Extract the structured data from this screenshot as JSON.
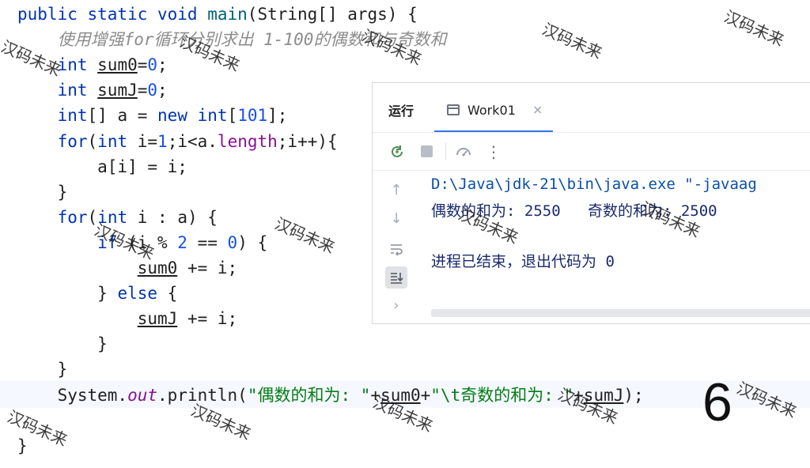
{
  "editor": {
    "lines": [
      {
        "segments": [
          {
            "t": "public static void ",
            "c": "kw"
          },
          {
            "t": "main",
            "c": "fn"
          },
          {
            "t": "(String[] args) {",
            "c": ""
          }
        ]
      },
      {
        "segments": [
          {
            "t": "    使用增强for循环分别求出 1-100的偶数和与奇数和",
            "c": "comment"
          }
        ]
      },
      {
        "segments": [
          {
            "t": "    int ",
            "c": "kw"
          },
          {
            "t": "sum0",
            "c": "underline"
          },
          {
            "t": "=",
            "c": ""
          },
          {
            "t": "0",
            "c": "num"
          },
          {
            "t": ";",
            "c": ""
          }
        ]
      },
      {
        "segments": [
          {
            "t": "    int ",
            "c": "kw"
          },
          {
            "t": "sumJ",
            "c": "underline"
          },
          {
            "t": "=",
            "c": ""
          },
          {
            "t": "0",
            "c": "num"
          },
          {
            "t": ";",
            "c": ""
          }
        ]
      },
      {
        "segments": [
          {
            "t": "    int",
            "c": "kw"
          },
          {
            "t": "[] a = ",
            "c": ""
          },
          {
            "t": "new int",
            "c": "kw"
          },
          {
            "t": "[",
            "c": ""
          },
          {
            "t": "101",
            "c": "num"
          },
          {
            "t": "];",
            "c": ""
          }
        ]
      },
      {
        "segments": [
          {
            "t": "    for",
            "c": "kw"
          },
          {
            "t": "(",
            "c": ""
          },
          {
            "t": "int ",
            "c": "kw"
          },
          {
            "t": "i=",
            "c": ""
          },
          {
            "t": "1",
            "c": "num"
          },
          {
            "t": ";i<a.",
            "c": ""
          },
          {
            "t": "length",
            "c": "field"
          },
          {
            "t": ";i++){",
            "c": ""
          }
        ]
      },
      {
        "segments": [
          {
            "t": "        a[i] = i;",
            "c": ""
          }
        ]
      },
      {
        "segments": [
          {
            "t": "    }",
            "c": ""
          }
        ]
      },
      {
        "segments": [
          {
            "t": "    for",
            "c": "kw"
          },
          {
            "t": "(",
            "c": ""
          },
          {
            "t": "int ",
            "c": "kw"
          },
          {
            "t": "i : a) {",
            "c": ""
          }
        ]
      },
      {
        "segments": [
          {
            "t": "        if ",
            "c": "kw"
          },
          {
            "t": "(i % ",
            "c": ""
          },
          {
            "t": "2",
            "c": "num"
          },
          {
            "t": " == ",
            "c": ""
          },
          {
            "t": "0",
            "c": "num"
          },
          {
            "t": ") {",
            "c": ""
          }
        ]
      },
      {
        "segments": [
          {
            "t": "            ",
            "c": ""
          },
          {
            "t": "sum0",
            "c": "underline"
          },
          {
            "t": " += i;",
            "c": ""
          }
        ]
      },
      {
        "segments": [
          {
            "t": "        } ",
            "c": ""
          },
          {
            "t": "else",
            "c": "kw"
          },
          {
            "t": " {",
            "c": ""
          }
        ]
      },
      {
        "segments": [
          {
            "t": "            ",
            "c": ""
          },
          {
            "t": "sumJ",
            "c": "underline"
          },
          {
            "t": " += i;",
            "c": ""
          }
        ]
      },
      {
        "segments": [
          {
            "t": "        }",
            "c": ""
          }
        ]
      },
      {
        "segments": [
          {
            "t": "    }",
            "c": ""
          }
        ]
      },
      {
        "segments": [
          {
            "t": "    System.",
            "c": ""
          },
          {
            "t": "out",
            "c": "italic"
          },
          {
            "t": ".println(",
            "c": ""
          },
          {
            "t": "\"偶数的和为: \"",
            "c": "str"
          },
          {
            "t": "+",
            "c": ""
          },
          {
            "t": "sum0",
            "c": "underline"
          },
          {
            "t": "+",
            "c": ""
          },
          {
            "t": "\"\\t奇数的和为: \"",
            "c": "str"
          },
          {
            "t": "+",
            "c": ""
          },
          {
            "t": "sumJ",
            "c": "underline"
          },
          {
            "t": ");",
            "c": ""
          }
        ]
      },
      {
        "segments": [
          {
            "t": "",
            "c": ""
          }
        ]
      },
      {
        "segments": [
          {
            "t": "}",
            "c": ""
          }
        ]
      }
    ]
  },
  "run_panel": {
    "title": "运行",
    "tab_label": "Work01",
    "tab_close": "×",
    "more_label": "⋮",
    "output": {
      "command": "D:\\Java\\jdk-21\\bin\\java.exe \"-javaag",
      "result": "偶数的和为: 2550   奇数的和为: 2500",
      "exit": "进程已结束，退出代码为 0"
    }
  },
  "overlay": {
    "big_number": "6"
  },
  "watermarks": [
    "汉码未来",
    "汉码未来",
    "汉码未来",
    "汉码未来",
    "汉码未来",
    "汉码未来",
    "汉码未来",
    "汉码未来",
    "汉码未来",
    "汉码未来",
    "汉码未来",
    "汉码未来",
    "汉码未来",
    "汉码未来",
    "汉码未来"
  ],
  "colors": {
    "keyword": "#0033b3",
    "number": "#1750eb",
    "string": "#067d17",
    "field": "#871094",
    "comment": "#8c8c8c",
    "tab_underline": "#3574f0"
  }
}
